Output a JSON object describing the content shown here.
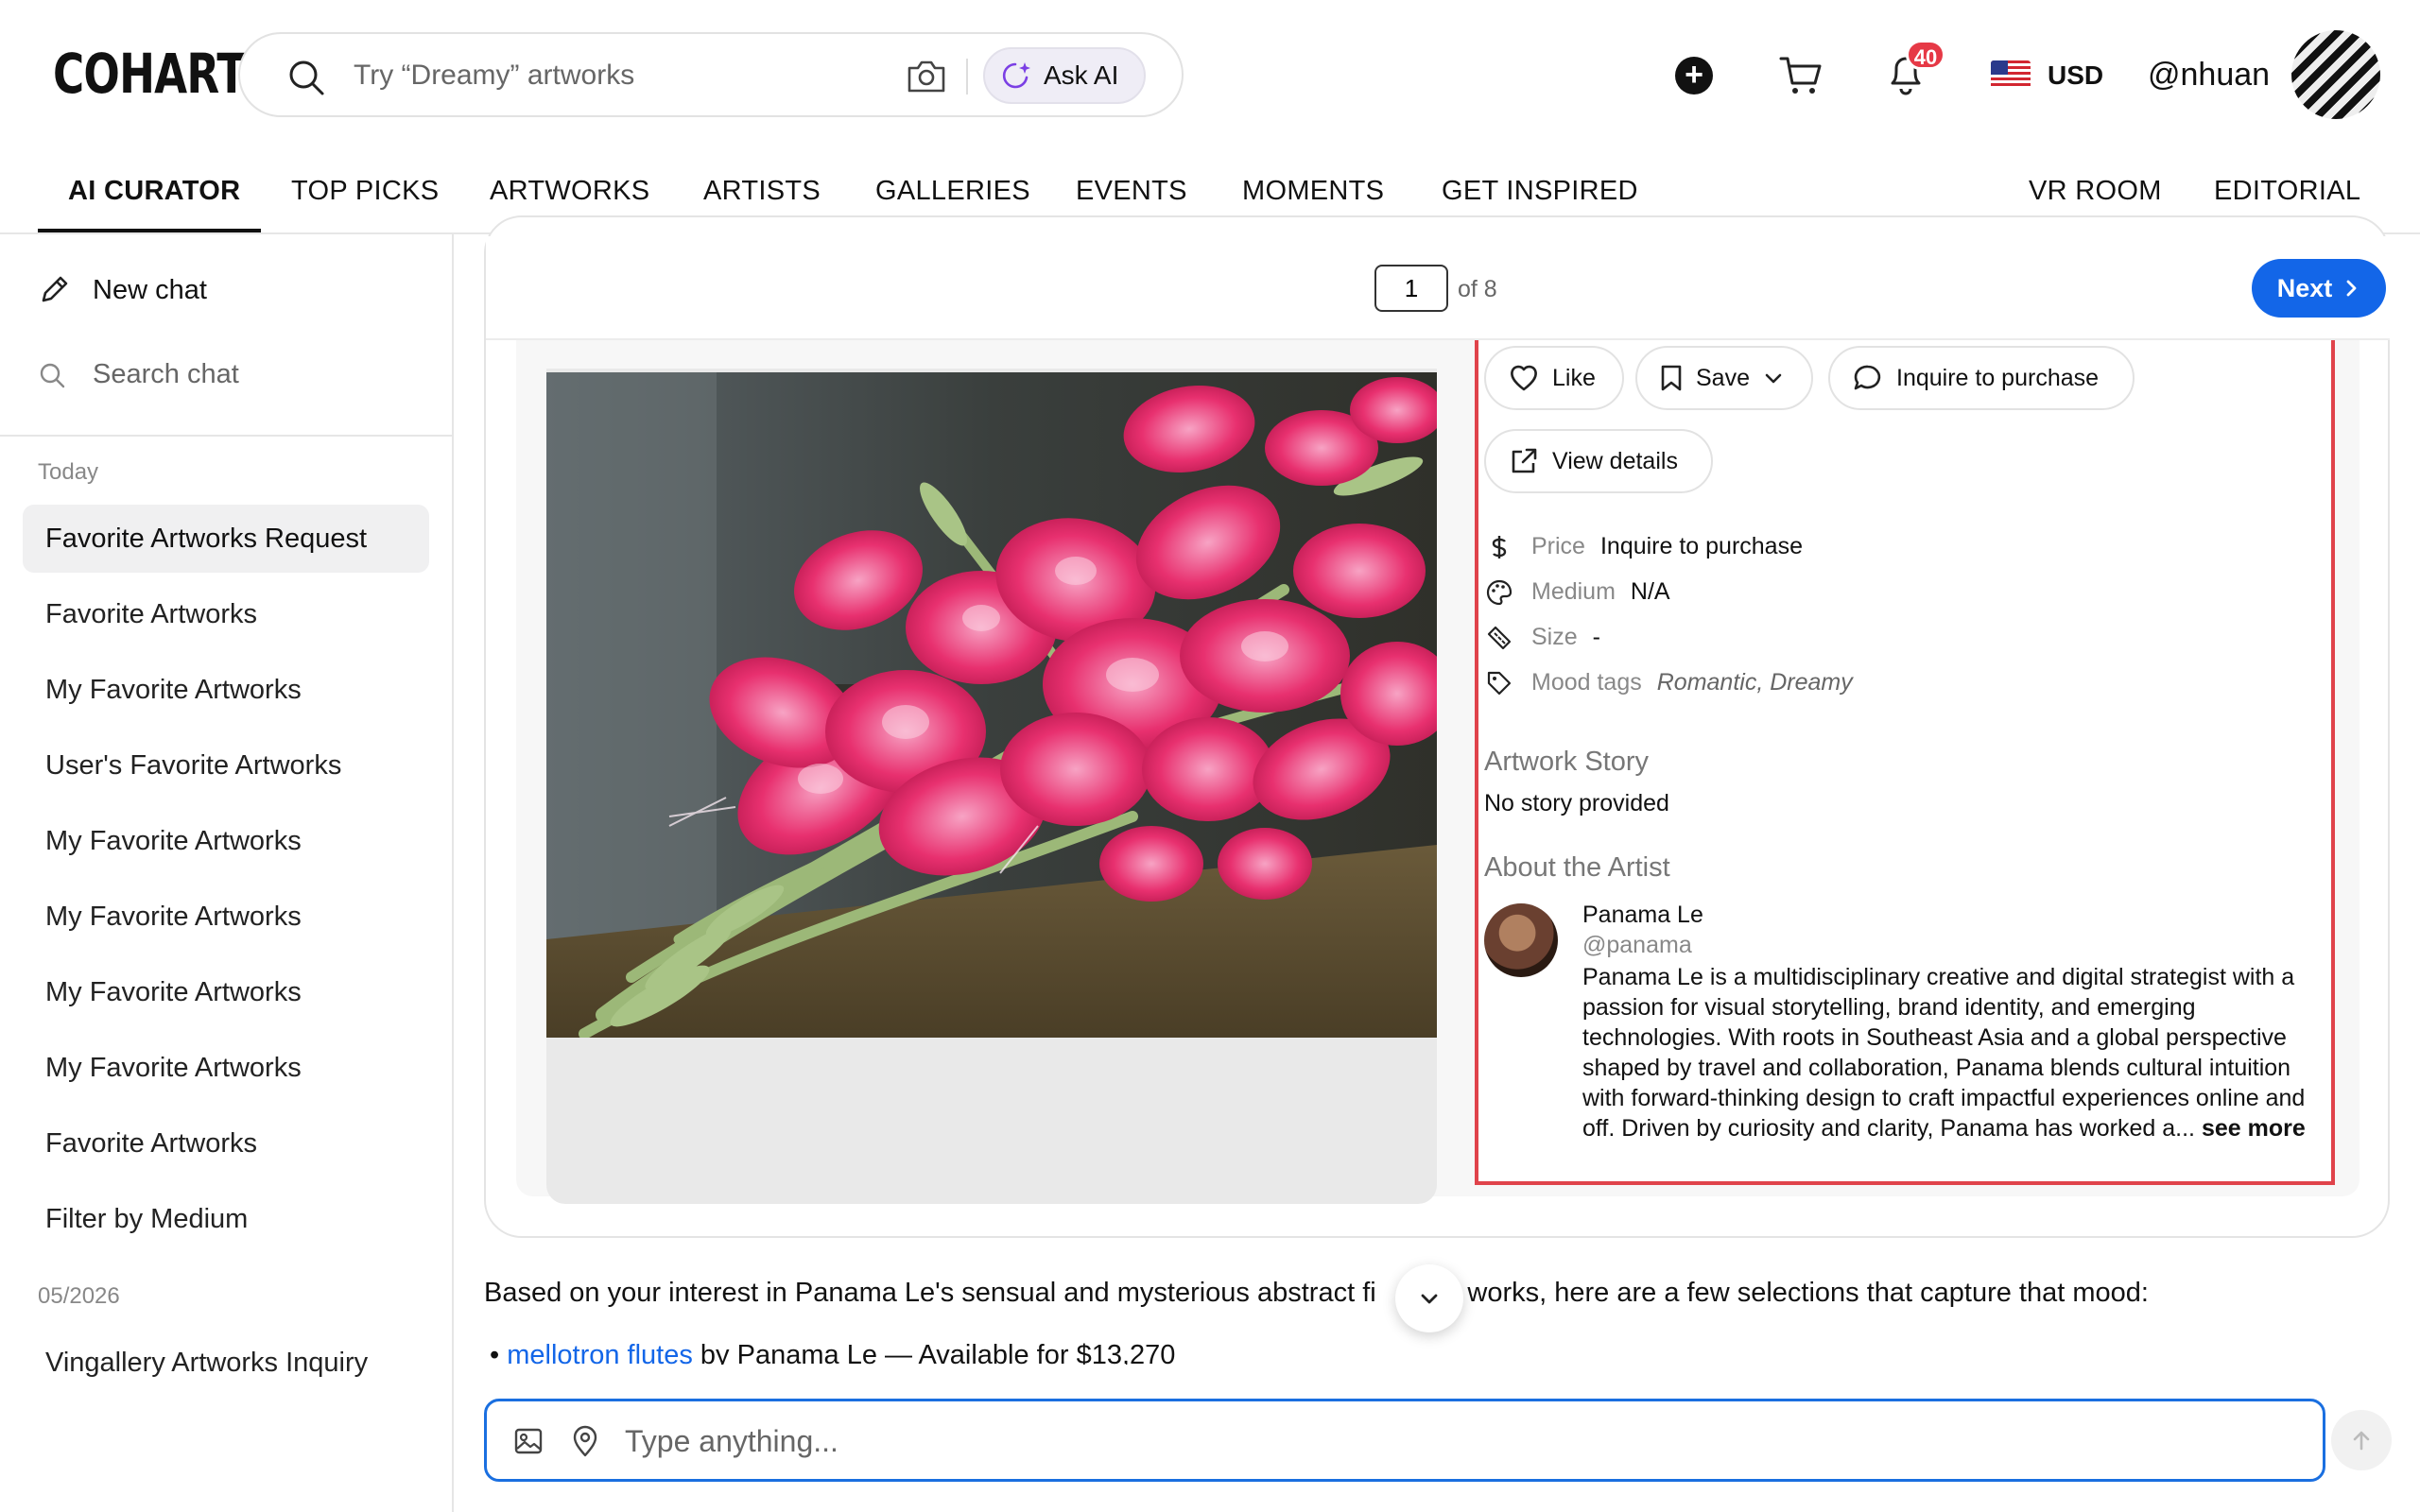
{
  "brand": {
    "logo": "COHART"
  },
  "search": {
    "placeholder": "Try “Dreamy” artworks",
    "ask_ai_label": "Ask AI"
  },
  "header": {
    "notifications_count": "40",
    "currency": "USD",
    "username": "@nhuan",
    "icons": [
      "plus-circle-icon",
      "cart-icon",
      "bell-icon",
      "us-flag-icon"
    ]
  },
  "nav": {
    "items": [
      {
        "label": "AI CURATOR",
        "active": true
      },
      {
        "label": "TOP PICKS"
      },
      {
        "label": "ARTWORKS"
      },
      {
        "label": "ARTISTS"
      },
      {
        "label": "GALLERIES"
      },
      {
        "label": "EVENTS"
      },
      {
        "label": "MOMENTS"
      },
      {
        "label": "GET INSPIRED"
      },
      {
        "label": "VR ROOM"
      },
      {
        "label": "EDITORIAL"
      }
    ]
  },
  "sidebar": {
    "new_chat_label": "New chat",
    "search_label": "Search chat",
    "sections": [
      {
        "title": "Today",
        "items": [
          {
            "label": "Favorite Artworks Request",
            "active": true
          },
          {
            "label": "Favorite Artworks"
          },
          {
            "label": "My Favorite Artworks"
          },
          {
            "label": "User's Favorite Artworks"
          },
          {
            "label": "My Favorite Artworks"
          },
          {
            "label": "My Favorite Artworks"
          },
          {
            "label": "My Favorite Artworks"
          },
          {
            "label": "My Favorite Artworks"
          },
          {
            "label": "Favorite Artworks"
          },
          {
            "label": "Filter by Medium"
          }
        ]
      },
      {
        "title": "05/2026",
        "items": [
          {
            "label": "Vingallery Artworks Inquiry"
          }
        ]
      }
    ]
  },
  "pager": {
    "current_page": "1",
    "of_label": "of 8",
    "next_label": "Next"
  },
  "artwork": {
    "actions": {
      "like_label": "Like",
      "save_label": "Save",
      "inquire_label": "Inquire to purchase",
      "view_details_label": "View details"
    },
    "meta": [
      {
        "icon": "dollar-icon",
        "key": "Price",
        "value": "Inquire to purchase"
      },
      {
        "icon": "palette-icon",
        "key": "Medium",
        "value": "N/A"
      },
      {
        "icon": "ruler-icon",
        "key": "Size",
        "value": "-"
      },
      {
        "icon": "tag-icon",
        "key": "Mood tags",
        "value": "Romantic, Dreamy"
      }
    ],
    "story_heading": "Artwork Story",
    "story_text": "No story provided",
    "artist_heading": "About the Artist",
    "artist": {
      "name": "Panama Le",
      "handle": "@panama",
      "bio": "Panama Le is a multidisciplinary creative and digital strategist with a passion for visual storytelling, brand identity, and emerging technologies. With roots in Southeast Asia and a global perspective shaped by travel and collaboration, Panama blends cultural intuition with forward-thinking design to craft impactful experiences online and off. Driven by curiosity and clarity, Panama has worked a...",
      "see_more_label": "see more"
    }
  },
  "chat": {
    "reply_text_before": "Based on your interest in Panama Le's sensual and mysterious abstract fi",
    "reply_text_after": "ve works, here are a few selections that capture that mood:",
    "bullet": {
      "link": "mellotron flutes",
      "rest": " by Panama Le — Available for $13,270"
    },
    "composer_placeholder": "Type anything..."
  },
  "colors": {
    "accent_blue": "#1366e8",
    "highlight_red": "#e0434b",
    "badge_red": "#e63946",
    "flower_pink": "#e8306f"
  }
}
